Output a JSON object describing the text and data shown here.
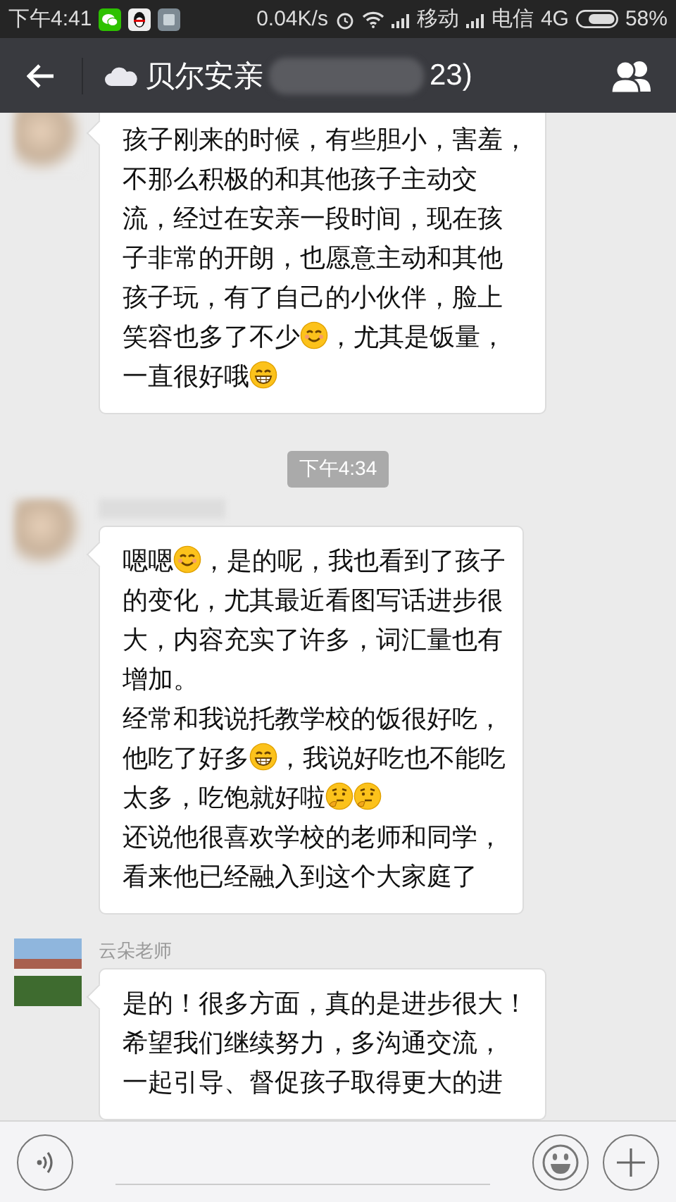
{
  "status_bar": {
    "time": "下午4:41",
    "speed": "0.04K/s",
    "carrier_1": "移动",
    "carrier_2": "电信",
    "network": "4G",
    "battery": "58%"
  },
  "header": {
    "title": "贝尔安亲",
    "title_end": "23)"
  },
  "chat": [
    {
      "kind": "message",
      "avatar": {
        "kind": "blurred"
      },
      "lines": [
        [
          {
            "kind": "text",
            "text": "孩子刚来的时候，有些胆小，害羞，"
          }
        ],
        [
          {
            "kind": "text",
            "text": "不那么积极的和其他孩子主动交"
          }
        ],
        [
          {
            "kind": "text",
            "text": "流，经过在安亲一段时间，现在孩"
          }
        ],
        [
          {
            "kind": "text",
            "text": "子非常的开朗，也愿意主动和其他"
          }
        ],
        [
          {
            "kind": "text",
            "text": "孩子玩，有了自己的小伙伴，脸上"
          }
        ],
        [
          {
            "kind": "text",
            "text": "笑容也多了不少"
          },
          {
            "kind": "smile"
          },
          {
            "kind": "text",
            "text": "，尤其是饭量，"
          }
        ],
        [
          {
            "kind": "text",
            "text": "一直很好哦"
          },
          {
            "kind": "grin"
          }
        ]
      ]
    },
    {
      "kind": "time",
      "text": "下午4:34"
    },
    {
      "kind": "message",
      "avatar": {
        "kind": "blurred"
      },
      "name_blurred": true,
      "lines": [
        [
          {
            "kind": "text",
            "text": "嗯嗯"
          },
          {
            "kind": "smile"
          },
          {
            "kind": "text",
            "text": "，是的呢，我也看到了孩子"
          }
        ],
        [
          {
            "kind": "text",
            "text": "的变化，尤其最近看图写话进步很"
          }
        ],
        [
          {
            "kind": "text",
            "text": "大，内容充实了许多，词汇量也有"
          }
        ],
        [
          {
            "kind": "text",
            "text": "增加。"
          }
        ],
        [
          {
            "kind": "text",
            "text": "经常和我说托教学校的饭很好吃，"
          }
        ],
        [
          {
            "kind": "text",
            "text": "他吃了好多"
          },
          {
            "kind": "grin"
          },
          {
            "kind": "text",
            "text": "，我说好吃也不能吃"
          }
        ],
        [
          {
            "kind": "text",
            "text": "太多，吃饱就好啦"
          },
          {
            "kind": "think"
          },
          {
            "kind": "think"
          }
        ],
        [
          {
            "kind": "text",
            "text": "还说他很喜欢学校的老师和同学，"
          }
        ],
        [
          {
            "kind": "text",
            "text": "看来他已经融入到这个大家庭了"
          }
        ]
      ]
    },
    {
      "kind": "message",
      "avatar": {
        "kind": "photo"
      },
      "name": "云朵老师",
      "lines": [
        [
          {
            "kind": "text",
            "text": "是的！很多方面，真的是进步很大！"
          }
        ],
        [
          {
            "kind": "text",
            "text": "希望我们继续努力，多沟通交流，"
          }
        ],
        [
          {
            "kind": "text",
            "text": "一起引导、督促孩子取得更大的进"
          }
        ]
      ]
    }
  ]
}
